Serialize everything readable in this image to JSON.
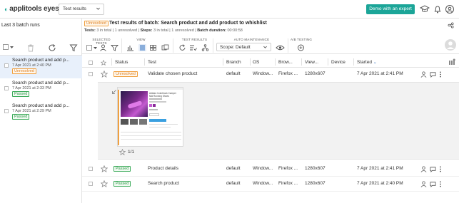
{
  "app": {
    "logo_text": "applitools eyes",
    "view_select": "Test results",
    "demo_button": "Demo with an expert"
  },
  "sidebar": {
    "title": "Last 3 batch runs",
    "batches": [
      {
        "name": "Search product and add p...",
        "date": "7 Apr 2021 at 2:40 PM",
        "status": "Unresolved",
        "selected": true
      },
      {
        "name": "Search product and add p...",
        "date": "7 Apr 2021 at 2:33 PM",
        "status": "Passed",
        "selected": false
      },
      {
        "name": "Search product and add p...",
        "date": "7 Apr 2021 at 2:29 PM",
        "status": "Passed",
        "selected": false
      }
    ]
  },
  "batch_header": {
    "status": "Unresolved",
    "title": "Test results of batch: Search product and add product to whishlist",
    "tests_label": "Tests:",
    "tests_value": "3 in total",
    "tests_unresolved": "1 unresolved",
    "steps_label": "Steps:",
    "steps_value": "3 in total",
    "steps_unresolved": "1 unresolved",
    "duration_label": "Batch duration:",
    "duration_value": "00:00:58"
  },
  "toolbar": {
    "groups": {
      "selected_tests": "SELECTED TESTS",
      "view": "VIEW",
      "test_results": "TEST RESULTS",
      "auto_maintenance": "AUTO MAINTENANCE",
      "ab_testing": "A/B TESTING"
    },
    "scope": "Scope: Default"
  },
  "table": {
    "columns": {
      "status": "Status",
      "test": "Test",
      "branch": "Branch",
      "os": "OS",
      "browser": "Brow...",
      "viewport": "View...",
      "device": "Device",
      "started": "Started"
    },
    "rows": [
      {
        "status": "Unresolved",
        "test": "Validate chosen product",
        "branch": "default",
        "os": "Window...",
        "browser": "Firefox ...",
        "viewport": "1280x607",
        "device": "",
        "started": "7 Apr 2021 at 2:41 PM"
      },
      {
        "status": "Passed",
        "test": "Product details",
        "branch": "default",
        "os": "Window...",
        "browser": "Firefox ...",
        "viewport": "1280x607",
        "device": "",
        "started": "7 Apr 2021 at 2:41 PM"
      },
      {
        "status": "Passed",
        "test": "Search product",
        "branch": "default",
        "os": "Window...",
        "browser": "Firefox ...",
        "viewport": "1280x607",
        "device": "",
        "started": "7 Apr 2021 at 2:40 PM"
      }
    ],
    "preview": {
      "step_count": "1/1",
      "thumb_title": "Adidas Colorblock Camper Mid Running Shoes"
    }
  },
  "colors": {
    "accent": "#1ba598",
    "unresolved": "#e08020",
    "passed": "#2d9a48",
    "selected_row": "#e8f0fb"
  }
}
